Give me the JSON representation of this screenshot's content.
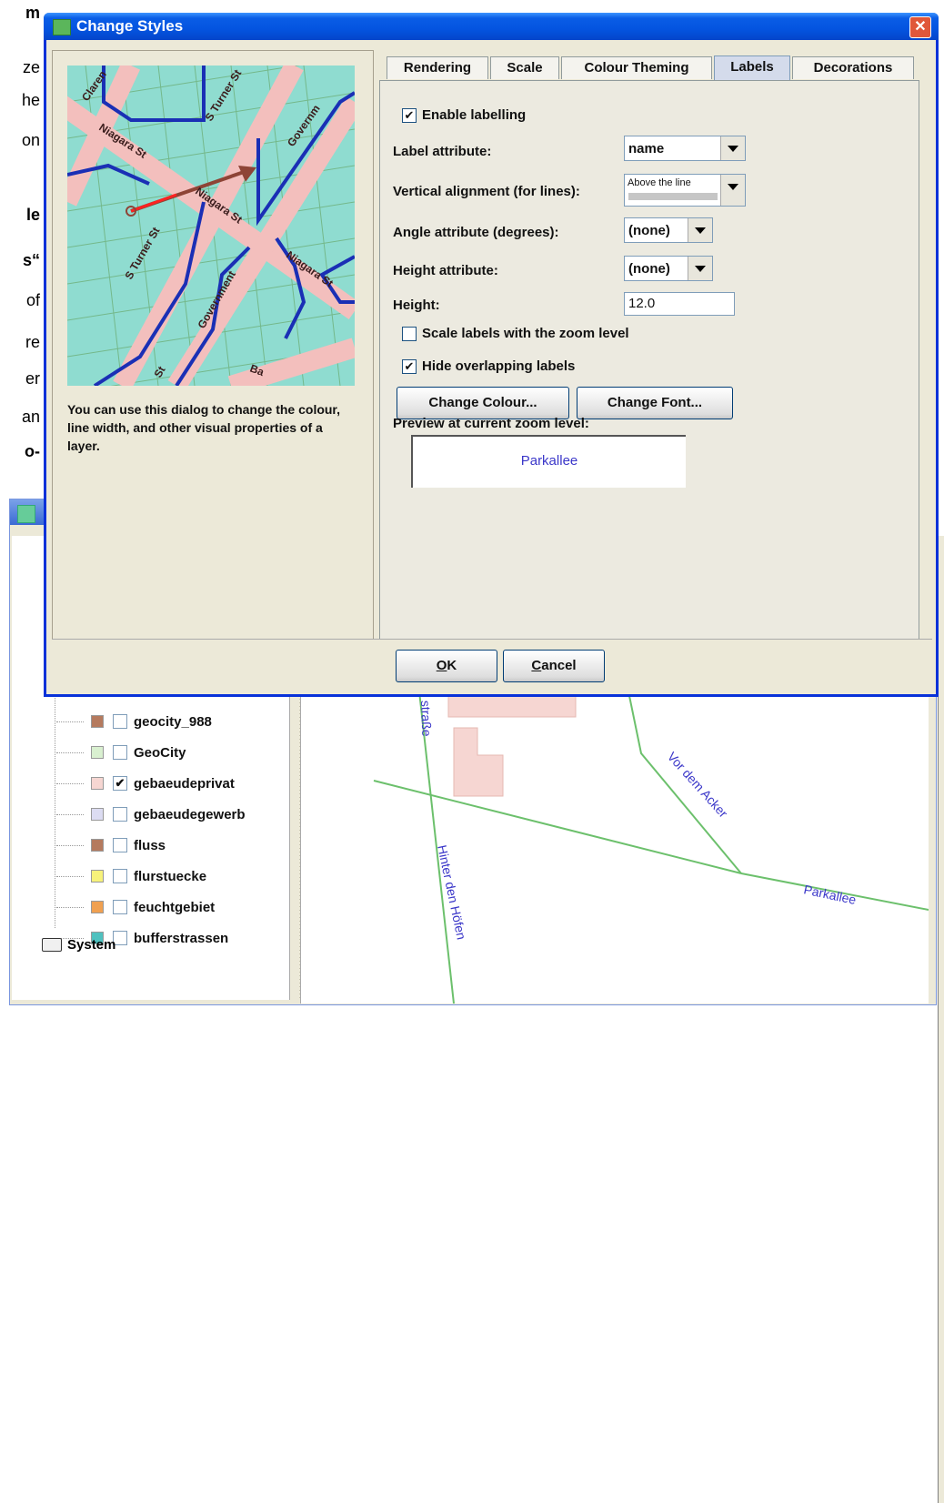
{
  "background_text": [
    {
      "text": "m",
      "bold": true
    },
    {
      "text": "ze",
      "bold": false
    },
    {
      "text": "he",
      "bold": false
    },
    {
      "text": "on",
      "bold": false
    },
    {
      "text": "le",
      "bold": true
    },
    {
      "text": "s“",
      "bold": true
    },
    {
      "text": "of",
      "bold": false
    },
    {
      "text": "re",
      "bold": false
    },
    {
      "text": "er",
      "bold": false
    },
    {
      "text": "an",
      "bold": false
    },
    {
      "text": "o-",
      "bold": true
    }
  ],
  "dialog": {
    "title": "Change Styles",
    "close_glyph": "✕",
    "description": "You can use this dialog to change the colour, line width, and other visual properties of a layer.",
    "preview_map": {
      "street_labels": [
        "Claren",
        "S Turner St",
        "Niagara St",
        "Governm",
        "Niagara St",
        "S Turner St",
        "Niagara St",
        "Government",
        "St",
        "Ba"
      ]
    },
    "tabs": [
      {
        "label": "Rendering",
        "active": false
      },
      {
        "label": "Scale",
        "active": false
      },
      {
        "label": "Colour Theming",
        "active": false
      },
      {
        "label": "Labels",
        "active": true
      },
      {
        "label": "Decorations",
        "active": false
      }
    ],
    "labels_tab": {
      "enable_labelling": {
        "label": "Enable labelling",
        "checked": true
      },
      "label_attribute": {
        "label": "Label attribute:",
        "value": "name"
      },
      "vertical_alignment": {
        "label": "Vertical alignment (for lines):",
        "value": "Above the line"
      },
      "angle_attribute": {
        "label": "Angle attribute (degrees):",
        "value": "(none)"
      },
      "height_attribute": {
        "label": "Height attribute:",
        "value": "(none)"
      },
      "height": {
        "label": "Height:",
        "value": "12.0"
      },
      "scale_labels": {
        "label": "Scale labels with the zoom level",
        "checked": false
      },
      "hide_overlapping": {
        "label": "Hide overlapping labels",
        "checked": true
      },
      "change_colour_button": "Change Colour...",
      "change_font_button": "Change Font...",
      "preview_label": "Preview at current zoom level:",
      "preview_text": "Parkallee"
    },
    "ok_button": {
      "mnemonic": "O",
      "rest": "K"
    },
    "cancel_button": {
      "mnemonic": "C",
      "rest": "ancel"
    }
  },
  "layer_tree": {
    "items": [
      {
        "name": "geocity_988",
        "swatch": "#b57a5e",
        "checked": false
      },
      {
        "name": "GeoCity",
        "swatch": "#d9f0d0",
        "checked": false
      },
      {
        "name": "gebaeudeprivat",
        "swatch": "#f6d6d2",
        "checked": true
      },
      {
        "name": "gebaeudegewerb",
        "swatch": "#dcdcf2",
        "checked": false
      },
      {
        "name": "fluss",
        "swatch": "#b57a5e",
        "checked": false
      },
      {
        "name": "flurstuecke",
        "swatch": "#f7f27a",
        "checked": false
      },
      {
        "name": "feuchtgebiet",
        "swatch": "#f0a050",
        "checked": false
      },
      {
        "name": "bufferstrassen",
        "swatch": "#4fc1bf",
        "checked": false
      }
    ],
    "system_label": "System"
  },
  "map": {
    "street_labels": [
      "straße",
      "Vor dem Acker",
      "Hinter den Höfen",
      "Parkallee"
    ]
  }
}
